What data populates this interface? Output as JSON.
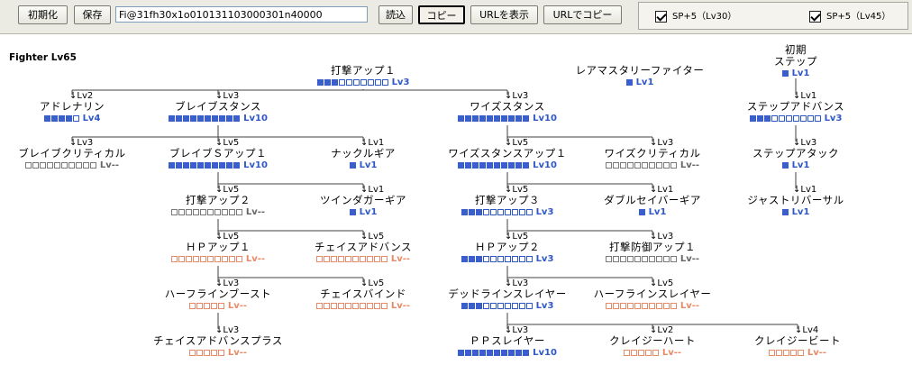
{
  "toolbar": {
    "init_label": "初期化",
    "save_label": "保存",
    "code_value": "Fi@31fh30x1o010131103000301n40000",
    "load_label": "読込",
    "copy_label": "コピー",
    "show_url_label": "URLを表示",
    "copy_url_label": "URLでコピー",
    "options": [
      {
        "label": "SP+5（Lv30）",
        "checked": true
      },
      {
        "label": "SP+5（Lv45）",
        "checked": true
      }
    ]
  },
  "character_label": "Fighter Lv65",
  "colors": {
    "blue": "#2e57c8",
    "gray": "#7a7a7a",
    "orange": "#e88a68",
    "line": "#404040"
  },
  "skills": [
    {
      "id": "dageki_up1",
      "name": "打撃アップ１",
      "lv_req": "",
      "level": "Lv3",
      "filled": 3,
      "total": 10,
      "color": "blue"
    },
    {
      "id": "lea_mastery",
      "name": "レアマスタリーファイター",
      "lv_req": "",
      "level": "Lv1",
      "filled": 1,
      "total": 1,
      "color": "blue"
    },
    {
      "id": "init_step",
      "name": "ステップ",
      "name_prefix": "初期",
      "lv_req": "",
      "level": "Lv1",
      "filled": 1,
      "total": 1,
      "color": "blue"
    },
    {
      "id": "adrenaline",
      "name": "アドレナリン",
      "lv_req": "Lv2",
      "level": "Lv4",
      "filled": 4,
      "total": 5,
      "color": "blue"
    },
    {
      "id": "brave_stance",
      "name": "ブレイブスタンス",
      "lv_req": "Lv3",
      "level": "Lv10",
      "filled": 10,
      "total": 10,
      "color": "blue"
    },
    {
      "id": "wise_stance",
      "name": "ワイズスタンス",
      "lv_req": "Lv3",
      "level": "Lv10",
      "filled": 10,
      "total": 10,
      "color": "blue"
    },
    {
      "id": "step_advance",
      "name": "ステップアドバンス",
      "lv_req": "Lv1",
      "level": "Lv3",
      "filled": 3,
      "total": 10,
      "color": "blue"
    },
    {
      "id": "brave_critical",
      "name": "ブレイブクリティカル",
      "lv_req": "Lv3",
      "level": "Lv--",
      "filled": 0,
      "total": 10,
      "color": "gray"
    },
    {
      "id": "brave_s_up1",
      "name": "ブレイブＳアップ１",
      "lv_req": "Lv5",
      "level": "Lv10",
      "filled": 10,
      "total": 10,
      "color": "blue"
    },
    {
      "id": "knuckle_gear",
      "name": "ナックルギア",
      "lv_req": "Lv1",
      "level": "Lv1",
      "filled": 1,
      "total": 1,
      "color": "blue"
    },
    {
      "id": "wise_stance_up1",
      "name": "ワイズスタンスアップ１",
      "lv_req": "Lv5",
      "level": "Lv10",
      "filled": 10,
      "total": 10,
      "color": "blue"
    },
    {
      "id": "wise_critical",
      "name": "ワイズクリティカル",
      "lv_req": "Lv3",
      "level": "Lv--",
      "filled": 0,
      "total": 10,
      "color": "gray"
    },
    {
      "id": "step_attack",
      "name": "ステップアタック",
      "lv_req": "Lv3",
      "level": "Lv1",
      "filled": 1,
      "total": 1,
      "color": "blue"
    },
    {
      "id": "dageki_up2",
      "name": "打撃アップ２",
      "lv_req": "Lv5",
      "level": "Lv--",
      "filled": 0,
      "total": 10,
      "color": "gray"
    },
    {
      "id": "twin_dagger_gear",
      "name": "ツインダガーギア",
      "lv_req": "Lv1",
      "level": "Lv1",
      "filled": 1,
      "total": 1,
      "color": "blue"
    },
    {
      "id": "dageki_up3",
      "name": "打撃アップ３",
      "lv_req": "Lv5",
      "level": "Lv3",
      "filled": 3,
      "total": 10,
      "color": "blue"
    },
    {
      "id": "double_saber_gear",
      "name": "ダブルセイバーギア",
      "lv_req": "Lv1",
      "level": "Lv1",
      "filled": 1,
      "total": 1,
      "color": "blue"
    },
    {
      "id": "just_reversal",
      "name": "ジャストリバーサル",
      "lv_req": "Lv1",
      "level": "Lv1",
      "filled": 1,
      "total": 1,
      "color": "blue"
    },
    {
      "id": "hp_up1",
      "name": "ＨＰアップ１",
      "lv_req": "Lv5",
      "level": "Lv--",
      "filled": 0,
      "total": 10,
      "color": "orange"
    },
    {
      "id": "chase_advance",
      "name": "チェイスアドバンス",
      "lv_req": "Lv5",
      "level": "Lv--",
      "filled": 0,
      "total": 10,
      "color": "orange"
    },
    {
      "id": "hp_up2",
      "name": "ＨＰアップ２",
      "lv_req": "Lv5",
      "level": "Lv3",
      "filled": 3,
      "total": 10,
      "color": "blue"
    },
    {
      "id": "dageki_bougyo_up1",
      "name": "打撃防御アップ１",
      "lv_req": "Lv3",
      "level": "Lv--",
      "filled": 0,
      "total": 10,
      "color": "gray"
    },
    {
      "id": "halfline_boost",
      "name": "ハーフラインブースト",
      "lv_req": "Lv3",
      "level": "Lv--",
      "filled": 0,
      "total": 5,
      "color": "orange"
    },
    {
      "id": "chase_bind",
      "name": "チェイスバインド",
      "lv_req": "Lv5",
      "level": "Lv--",
      "filled": 0,
      "total": 10,
      "color": "orange"
    },
    {
      "id": "deadline_slayer",
      "name": "デッドラインスレイヤー",
      "lv_req": "Lv3",
      "level": "Lv3",
      "filled": 3,
      "total": 10,
      "color": "blue"
    },
    {
      "id": "halfline_slayer",
      "name": "ハーフラインスレイヤー",
      "lv_req": "Lv5",
      "level": "Lv--",
      "filled": 0,
      "total": 10,
      "color": "orange"
    },
    {
      "id": "chase_advance_plus",
      "name": "チェイスアドバンスプラス",
      "lv_req": "Lv3",
      "level": "Lv--",
      "filled": 0,
      "total": 5,
      "color": "orange"
    },
    {
      "id": "pp_slayer",
      "name": "ＰＰスレイヤー",
      "lv_req": "Lv3",
      "level": "Lv10",
      "filled": 10,
      "total": 10,
      "color": "blue"
    },
    {
      "id": "crazy_heart",
      "name": "クレイジーハート",
      "lv_req": "Lv2",
      "level": "Lv--",
      "filled": 0,
      "total": 5,
      "color": "orange"
    },
    {
      "id": "crazy_beat",
      "name": "クレイジービート",
      "lv_req": "Lv4",
      "level": "Lv--",
      "filled": 0,
      "total": 5,
      "color": "orange"
    }
  ]
}
